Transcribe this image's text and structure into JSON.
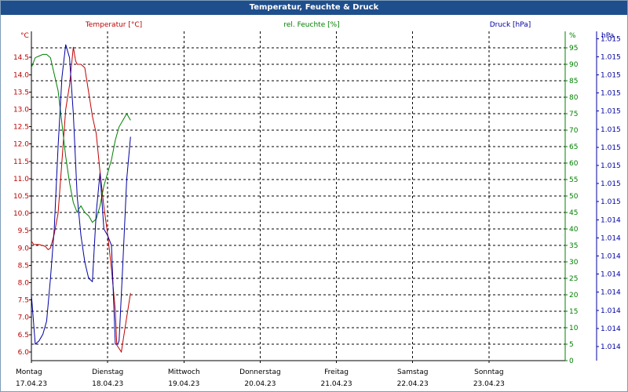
{
  "window": {
    "title": "Temperatur, Feuchte & Druck"
  },
  "colors": {
    "temperature": "#c00000",
    "humidity": "#008000",
    "pressure": "#0000a0",
    "grid": "#000000",
    "title_bg": "#1f4e8c"
  },
  "chart_data": {
    "type": "line",
    "title": "Temperatur, Feuchte & Druck",
    "grid": true,
    "x_days": [
      {
        "day": "Montag",
        "date": "17.04.23"
      },
      {
        "day": "Dienstag",
        "date": "18.04.23"
      },
      {
        "day": "Mittwoch",
        "date": "19.04.23"
      },
      {
        "day": "Donnerstag",
        "date": "20.04.23"
      },
      {
        "day": "Freitag",
        "date": "21.04.23"
      },
      {
        "day": "Samstag",
        "date": "22.04.23"
      },
      {
        "day": "Sonntag",
        "date": "23.04.23"
      }
    ],
    "axes": {
      "temperature": {
        "label": "Temperatur [°C]",
        "unit": "°C",
        "ylim": [
          5.75,
          15.25
        ],
        "ticks": [
          "6.0",
          "6.5",
          "7.0",
          "7.5",
          "8.0",
          "8.5",
          "9.0",
          "9.5",
          "10.0",
          "10.5",
          "11.0",
          "11.5",
          "12.0",
          "12.5",
          "13.0",
          "13.5",
          "14.0",
          "14.5"
        ]
      },
      "humidity": {
        "label": "rel. Feuchte [%]",
        "unit": "%",
        "ylim": [
          0,
          100
        ],
        "ticks": [
          "0",
          "5",
          "10",
          "15",
          "20",
          "25",
          "30",
          "35",
          "40",
          "45",
          "50",
          "55",
          "60",
          "65",
          "70",
          "75",
          "80",
          "85",
          "90",
          "95"
        ]
      },
      "pressure": {
        "label": "Druck [hPa]",
        "unit": "hPa",
        "ticks": [
          "1.014",
          "1.014",
          "1.014",
          "1.014",
          "1.014",
          "1.014",
          "1.014",
          "1.014",
          "1.015",
          "1.015",
          "1.015",
          "1.015",
          "1.015",
          "1.015",
          "1.015",
          "1.015",
          "1.015",
          "1.015"
        ]
      }
    },
    "series": [
      {
        "name": "Temperatur [°C]",
        "axis": "temperature",
        "color": "#c00000",
        "x": [
          0,
          0.03,
          0.1,
          0.18,
          0.22,
          0.25,
          0.3,
          0.35,
          0.4,
          0.45,
          0.5,
          0.55,
          0.58,
          0.6,
          0.65,
          0.7,
          0.75,
          0.8,
          0.85,
          0.9,
          0.95,
          1.0,
          1.05,
          1.1,
          1.12,
          1.15,
          1.18,
          1.2,
          1.25,
          1.3
        ],
        "values": [
          9.2,
          9.1,
          9.1,
          9.05,
          8.95,
          9.0,
          9.4,
          10.0,
          11.5,
          13.0,
          13.7,
          14.8,
          14.4,
          14.3,
          14.3,
          14.2,
          13.5,
          12.8,
          12.3,
          11.2,
          10.2,
          9.4,
          8.4,
          7.2,
          6.2,
          6.1,
          6.0,
          6.3,
          7.0,
          7.7
        ]
      },
      {
        "name": "rel. Feuchte [%]",
        "axis": "humidity",
        "color": "#008000",
        "x": [
          0,
          0.05,
          0.1,
          0.15,
          0.2,
          0.25,
          0.3,
          0.35,
          0.4,
          0.45,
          0.5,
          0.55,
          0.6,
          0.62,
          0.65,
          0.7,
          0.75,
          0.8,
          0.85,
          0.9,
          0.95,
          1.0,
          1.05,
          1.1,
          1.15,
          1.2,
          1.25,
          1.3
        ],
        "values": [
          89,
          92,
          92.5,
          93,
          93,
          92,
          87,
          82,
          72,
          62,
          54,
          48,
          45,
          46,
          47,
          45,
          44,
          42,
          43,
          47,
          53,
          57,
          61,
          67,
          71,
          73,
          75,
          73
        ]
      },
      {
        "name": "Druck [hPa]",
        "axis": "humidity",
        "color": "#0000a0",
        "x": [
          0,
          0.05,
          0.1,
          0.15,
          0.2,
          0.25,
          0.3,
          0.35,
          0.4,
          0.45,
          0.5,
          0.55,
          0.6,
          0.65,
          0.7,
          0.75,
          0.8,
          0.85,
          0.9,
          0.95,
          1.0,
          1.05,
          1.1,
          1.13,
          1.15,
          1.2,
          1.25,
          1.3
        ],
        "values": [
          20,
          5,
          6,
          8,
          12,
          25,
          40,
          65,
          86,
          96,
          92,
          75,
          50,
          38,
          30,
          25,
          24,
          45,
          57,
          40,
          38,
          35,
          5,
          5,
          6,
          30,
          55,
          68
        ]
      }
    ]
  }
}
